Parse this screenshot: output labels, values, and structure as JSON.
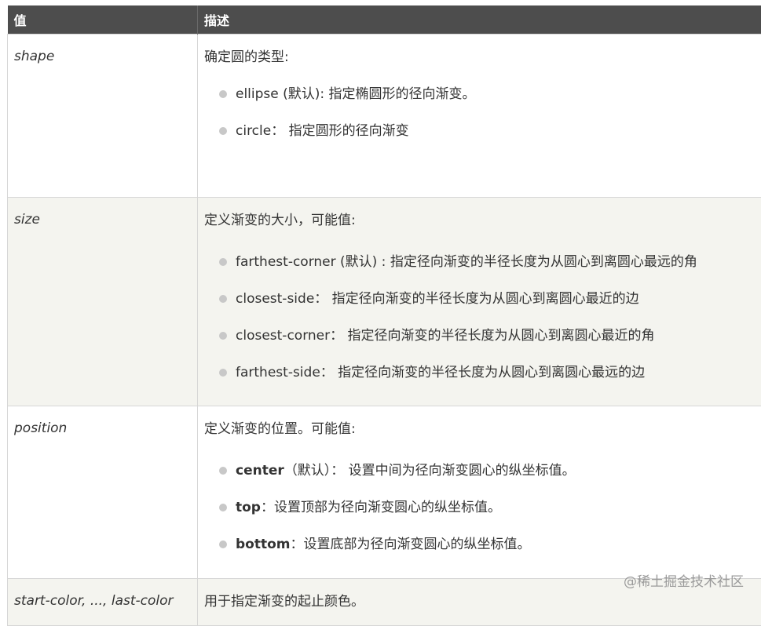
{
  "header": {
    "col_value": "值",
    "col_desc": "描述"
  },
  "rows": [
    {
      "value": "shape",
      "intro": "确定圆的类型:",
      "items": [
        {
          "key": "ellipse (默认)",
          "text": ": 指定椭圆形的径向渐变。"
        },
        {
          "key": "circle",
          "text": "： 指定圆形的径向渐变"
        }
      ]
    },
    {
      "value": "size",
      "intro": "定义渐变的大小，可能值:",
      "items": [
        {
          "key": "farthest-corner (默认)",
          "text": " : 指定径向渐变的半径长度为从圆心到离圆心最远的角"
        },
        {
          "key": "closest-side",
          "text": "： 指定径向渐变的半径长度为从圆心到离圆心最近的边"
        },
        {
          "key": "closest-corner",
          "text": "：  指定径向渐变的半径长度为从圆心到离圆心最近的角"
        },
        {
          "key": "farthest-side",
          "text": "： 指定径向渐变的半径长度为从圆心到离圆心最远的边"
        }
      ]
    },
    {
      "value": "position",
      "intro": "定义渐变的位置。可能值:",
      "items": [
        {
          "key": "center",
          "text": "（默认）： 设置中间为径向渐变圆心的纵坐标值。"
        },
        {
          "key": "top",
          "text": "：设置顶部为径向渐变圆心的纵坐标值。"
        },
        {
          "key": "bottom",
          "text": "：设置底部为径向渐变圆心的纵坐标值。"
        }
      ]
    },
    {
      "value": "start-color, ..., last-color",
      "intro": "用于指定渐变的起止颜色。"
    }
  ],
  "watermark": "@稀土掘金技术社区",
  "colors": {
    "header_bg": "#4d4d4d",
    "alt_row_bg": "#f4f4ef",
    "bullet": "#c8c8c8"
  }
}
